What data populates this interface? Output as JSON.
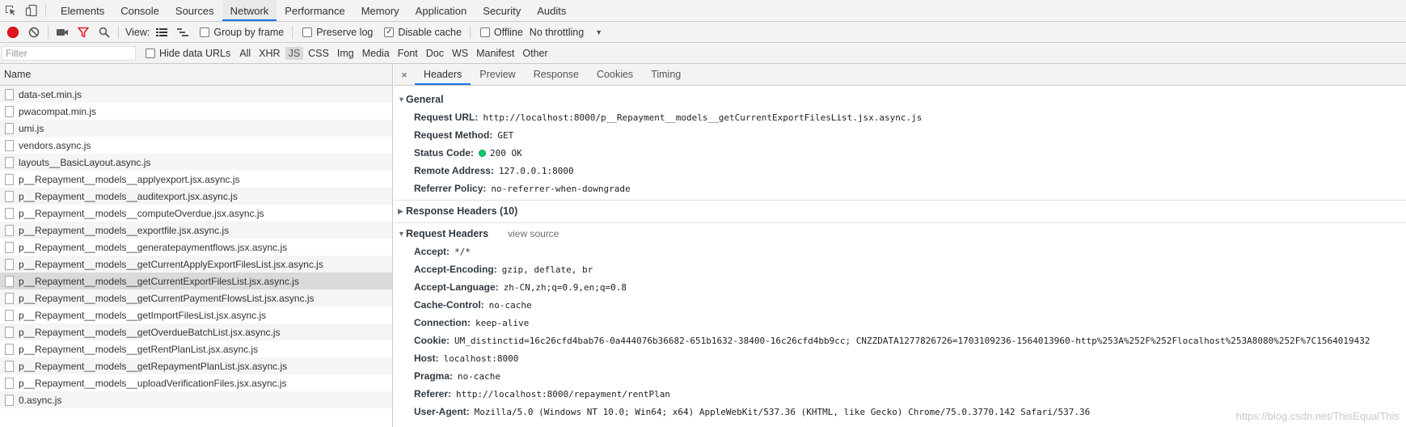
{
  "top_tabs": [
    "Elements",
    "Console",
    "Sources",
    "Network",
    "Performance",
    "Memory",
    "Application",
    "Security",
    "Audits"
  ],
  "active_top_tab": "Network",
  "toolbar": {
    "view_label": "View:",
    "group_by_frame": "Group by frame",
    "preserve_log": "Preserve log",
    "disable_cache": "Disable cache",
    "offline": "Offline",
    "throttling": "No throttling",
    "group_by_frame_checked": false,
    "preserve_log_checked": false,
    "disable_cache_checked": true,
    "offline_checked": false
  },
  "filterbar": {
    "filter_placeholder": "Filter",
    "hide_data_urls": "Hide data URLs",
    "types": [
      "All",
      "XHR",
      "JS",
      "CSS",
      "Img",
      "Media",
      "Font",
      "Doc",
      "WS",
      "Manifest",
      "Other"
    ],
    "active_type": "JS"
  },
  "request_list": {
    "header": "Name",
    "items": [
      "data-set.min.js",
      "pwacompat.min.js",
      "umi.js",
      "vendors.async.js",
      "layouts__BasicLayout.async.js",
      "p__Repayment__models__applyexport.jsx.async.js",
      "p__Repayment__models__auditexport.jsx.async.js",
      "p__Repayment__models__computeOverdue.jsx.async.js",
      "p__Repayment__models__exportfile.jsx.async.js",
      "p__Repayment__models__generatepaymentflows.jsx.async.js",
      "p__Repayment__models__getCurrentApplyExportFilesList.jsx.async.js",
      "p__Repayment__models__getCurrentExportFilesList.jsx.async.js",
      "p__Repayment__models__getCurrentPaymentFlowsList.jsx.async.js",
      "p__Repayment__models__getImportFilesList.jsx.async.js",
      "p__Repayment__models__getOverdueBatchList.jsx.async.js",
      "p__Repayment__models__getRentPlanList.jsx.async.js",
      "p__Repayment__models__getRepaymentPlanList.jsx.async.js",
      "p__Repayment__models__uploadVerificationFiles.jsx.async.js",
      "0.async.js"
    ],
    "selected_index": 11
  },
  "detail": {
    "close_symbol": "×",
    "tabs": [
      "Headers",
      "Preview",
      "Response",
      "Cookies",
      "Timing"
    ],
    "active_tab": "Headers",
    "general": {
      "title": "General",
      "rows": [
        {
          "name": "Request URL:",
          "value": "http://localhost:8000/p__Repayment__models__getCurrentExportFilesList.jsx.async.js"
        },
        {
          "name": "Request Method:",
          "value": "GET"
        },
        {
          "name": "Status Code:",
          "value": "200 OK"
        },
        {
          "name": "Remote Address:",
          "value": "127.0.0.1:8000"
        },
        {
          "name": "Referrer Policy:",
          "value": "no-referrer-when-downgrade"
        }
      ]
    },
    "response_headers": {
      "title": "Response Headers (10)"
    },
    "request_headers": {
      "title": "Request Headers",
      "view_source": "view source",
      "rows": [
        {
          "name": "Accept:",
          "value": "*/*"
        },
        {
          "name": "Accept-Encoding:",
          "value": "gzip, deflate, br"
        },
        {
          "name": "Accept-Language:",
          "value": "zh-CN,zh;q=0.9,en;q=0.8"
        },
        {
          "name": "Cache-Control:",
          "value": "no-cache"
        },
        {
          "name": "Connection:",
          "value": "keep-alive"
        },
        {
          "name": "Cookie:",
          "value": "UM_distinctid=16c26cfd4bab76-0a444076b36682-651b1632-38400-16c26cfd4bb9cc; CNZZDATA1277826726=1703109236-1564013960-http%253A%252F%252Flocalhost%253A8080%252F%7C1564019432"
        },
        {
          "name": "Host:",
          "value": "localhost:8000"
        },
        {
          "name": "Pragma:",
          "value": "no-cache"
        },
        {
          "name": "Referer:",
          "value": "http://localhost:8000/repayment/rentPlan"
        },
        {
          "name": "User-Agent:",
          "value": "Mozilla/5.0 (Windows NT 10.0; Win64; x64) AppleWebKit/537.36 (KHTML, like Gecko) Chrome/75.0.3770.142 Safari/537.36"
        }
      ]
    }
  },
  "watermark": "https://blog.csdn.net/ThisEqualThis",
  "colors": {
    "accent": "#1a73e8",
    "record": "#e0151f",
    "filter_icon": "#e8202b",
    "status_ok": "#0cce6b"
  }
}
